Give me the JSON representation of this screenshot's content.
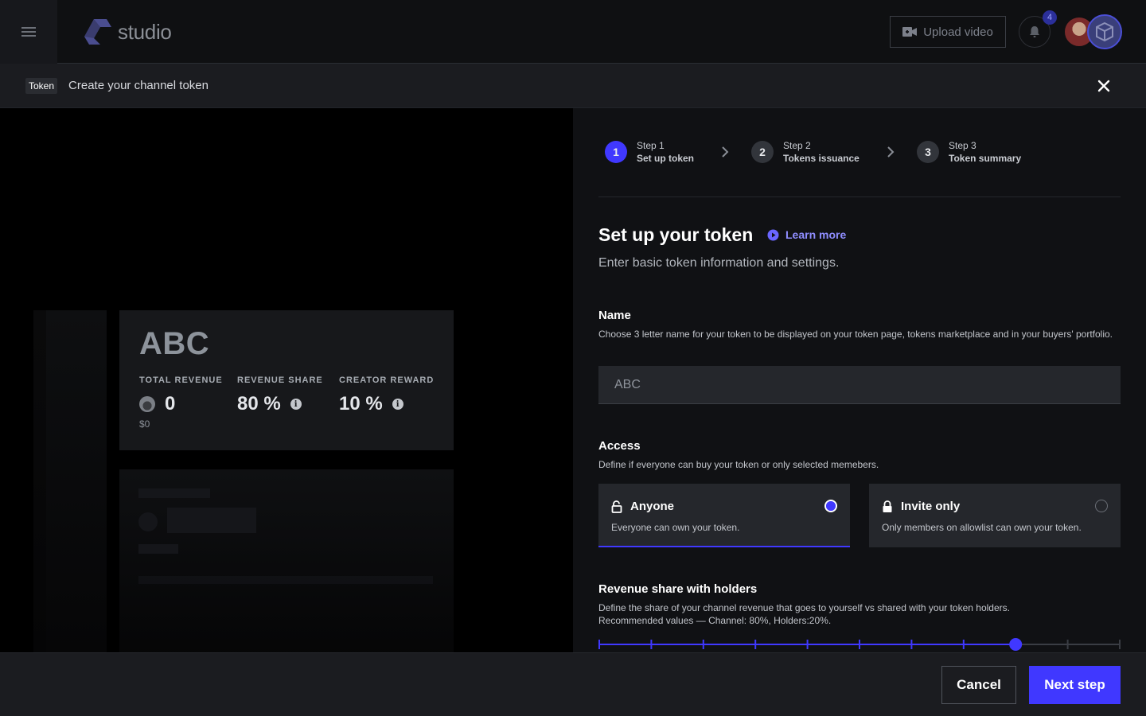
{
  "topbar": {
    "logo_text": "studio",
    "upload_label": "Upload video",
    "notification_count": "4"
  },
  "subheader": {
    "pill": "Token",
    "title": "Create your channel token"
  },
  "preview": {
    "ticker": "ABC",
    "stats": [
      {
        "label": "TOTAL REVENUE",
        "value": "0",
        "sub": "$0"
      },
      {
        "label": "REVENUE SHARE",
        "value": "80 %"
      },
      {
        "label": "CREATOR REWARD",
        "value": "10 %"
      }
    ]
  },
  "steps": [
    {
      "kicker": "Step 1",
      "title": "Set up token",
      "number": "1",
      "active": true
    },
    {
      "kicker": "Step 2",
      "title": "Tokens issuance",
      "number": "2",
      "active": false
    },
    {
      "kicker": "Step 3",
      "title": "Token summary",
      "number": "3",
      "active": false
    }
  ],
  "form": {
    "title": "Set up your token",
    "learn_more": "Learn more",
    "subtitle": "Enter basic token information and settings.",
    "name": {
      "label": "Name",
      "help": "Choose 3 letter name for your token to be displayed on your token page, tokens marketplace and in your buyers' portfolio.",
      "placeholder": "ABC",
      "value": ""
    },
    "access": {
      "label": "Access",
      "help": "Define if everyone can buy your token or only selected memebers.",
      "options": [
        {
          "title": "Anyone",
          "desc": "Everyone can own your token.",
          "selected": true
        },
        {
          "title": "Invite only",
          "desc": "Only members on allowlist can own your token.",
          "selected": false
        }
      ]
    },
    "revenue": {
      "label": "Revenue share with holders",
      "help_line1": "Define the share of your channel revenue that goes to yourself vs shared with your token holders.",
      "help_line2": "Recommended values — Channel: 80%, Holders:20%.",
      "value_percent": 80,
      "ticks": 11
    }
  },
  "footer": {
    "cancel": "Cancel",
    "next": "Next step"
  },
  "colors": {
    "accent": "#4038ff",
    "link": "#8f8dff",
    "background": "#101114"
  }
}
